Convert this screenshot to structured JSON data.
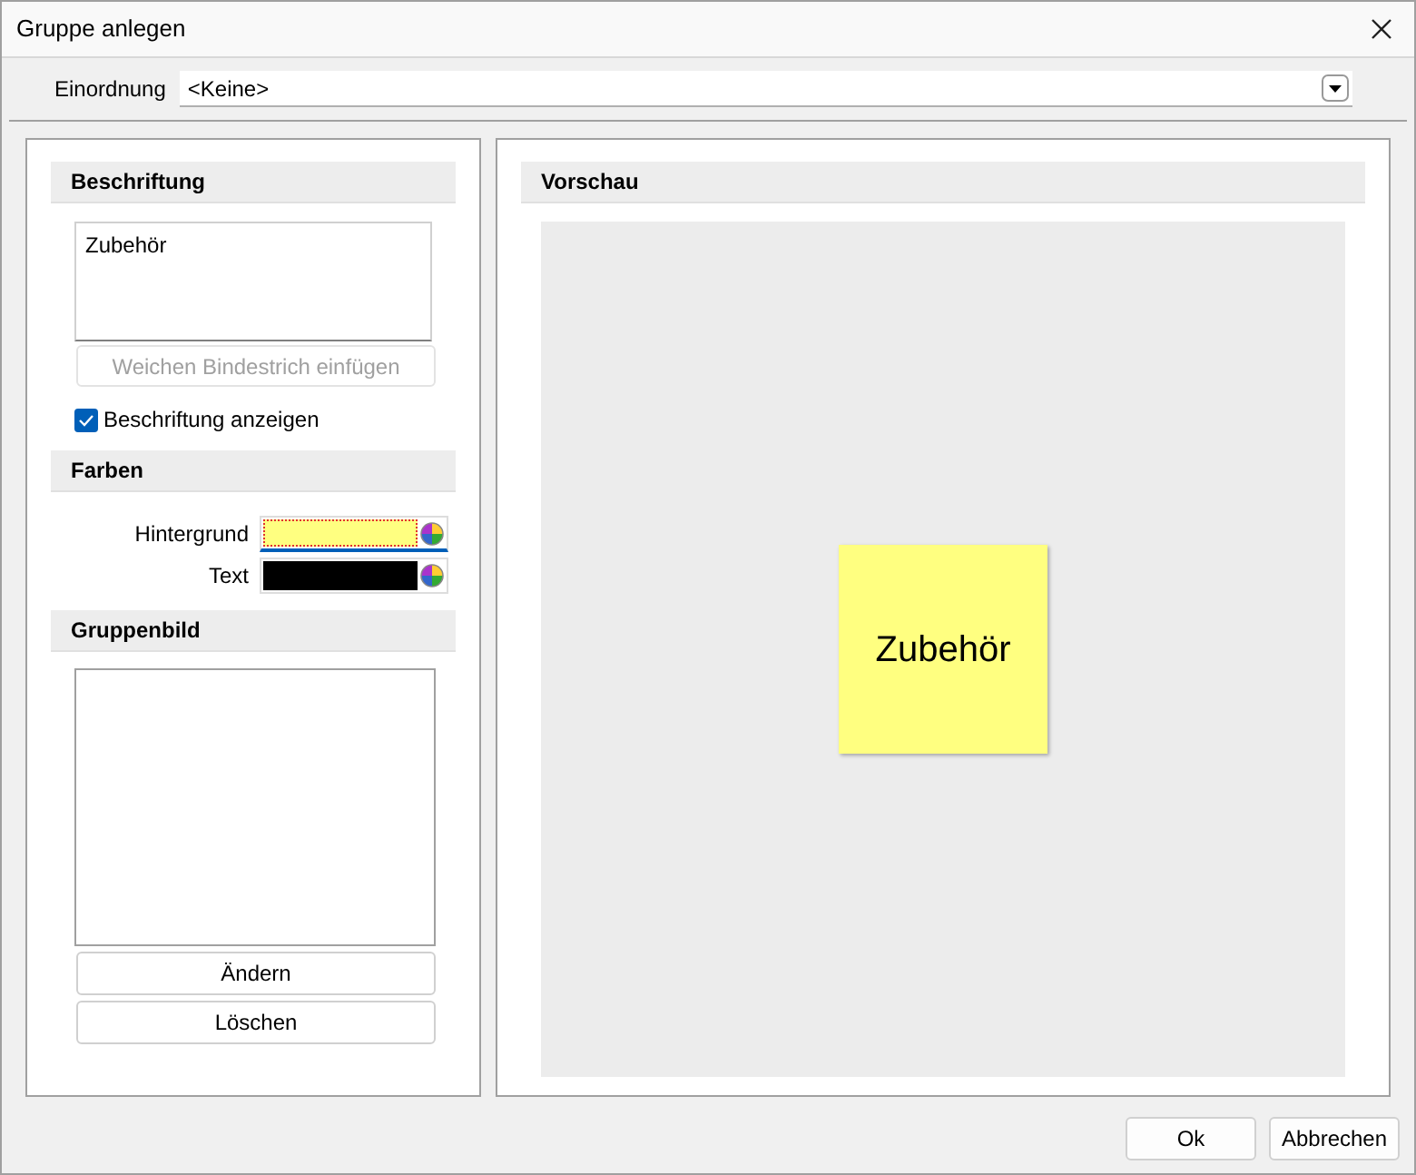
{
  "window": {
    "title": "Gruppe anlegen"
  },
  "einordnung": {
    "label": "Einordnung",
    "value": "<Keine>"
  },
  "caption": {
    "header": "Beschriftung",
    "text": "Zubehör",
    "hyphen_button": {
      "label": "Weichen Bindestrich einfügen",
      "disabled": true
    },
    "show_caption": {
      "label": "Beschriftung anzeigen",
      "checked": true
    }
  },
  "colors": {
    "header": "Farben",
    "rows": [
      {
        "label": "Hintergrund",
        "color": "#ffff80",
        "focused": true
      },
      {
        "label": "Text",
        "color": "#000000",
        "focused": false
      }
    ]
  },
  "group_image": {
    "header": "Gruppenbild",
    "buttons": [
      "Ändern",
      "Löschen"
    ]
  },
  "preview": {
    "header": "Vorschau",
    "note_text": "Zubehör"
  },
  "buttons": [
    "Ok",
    "Abbrechen"
  ]
}
